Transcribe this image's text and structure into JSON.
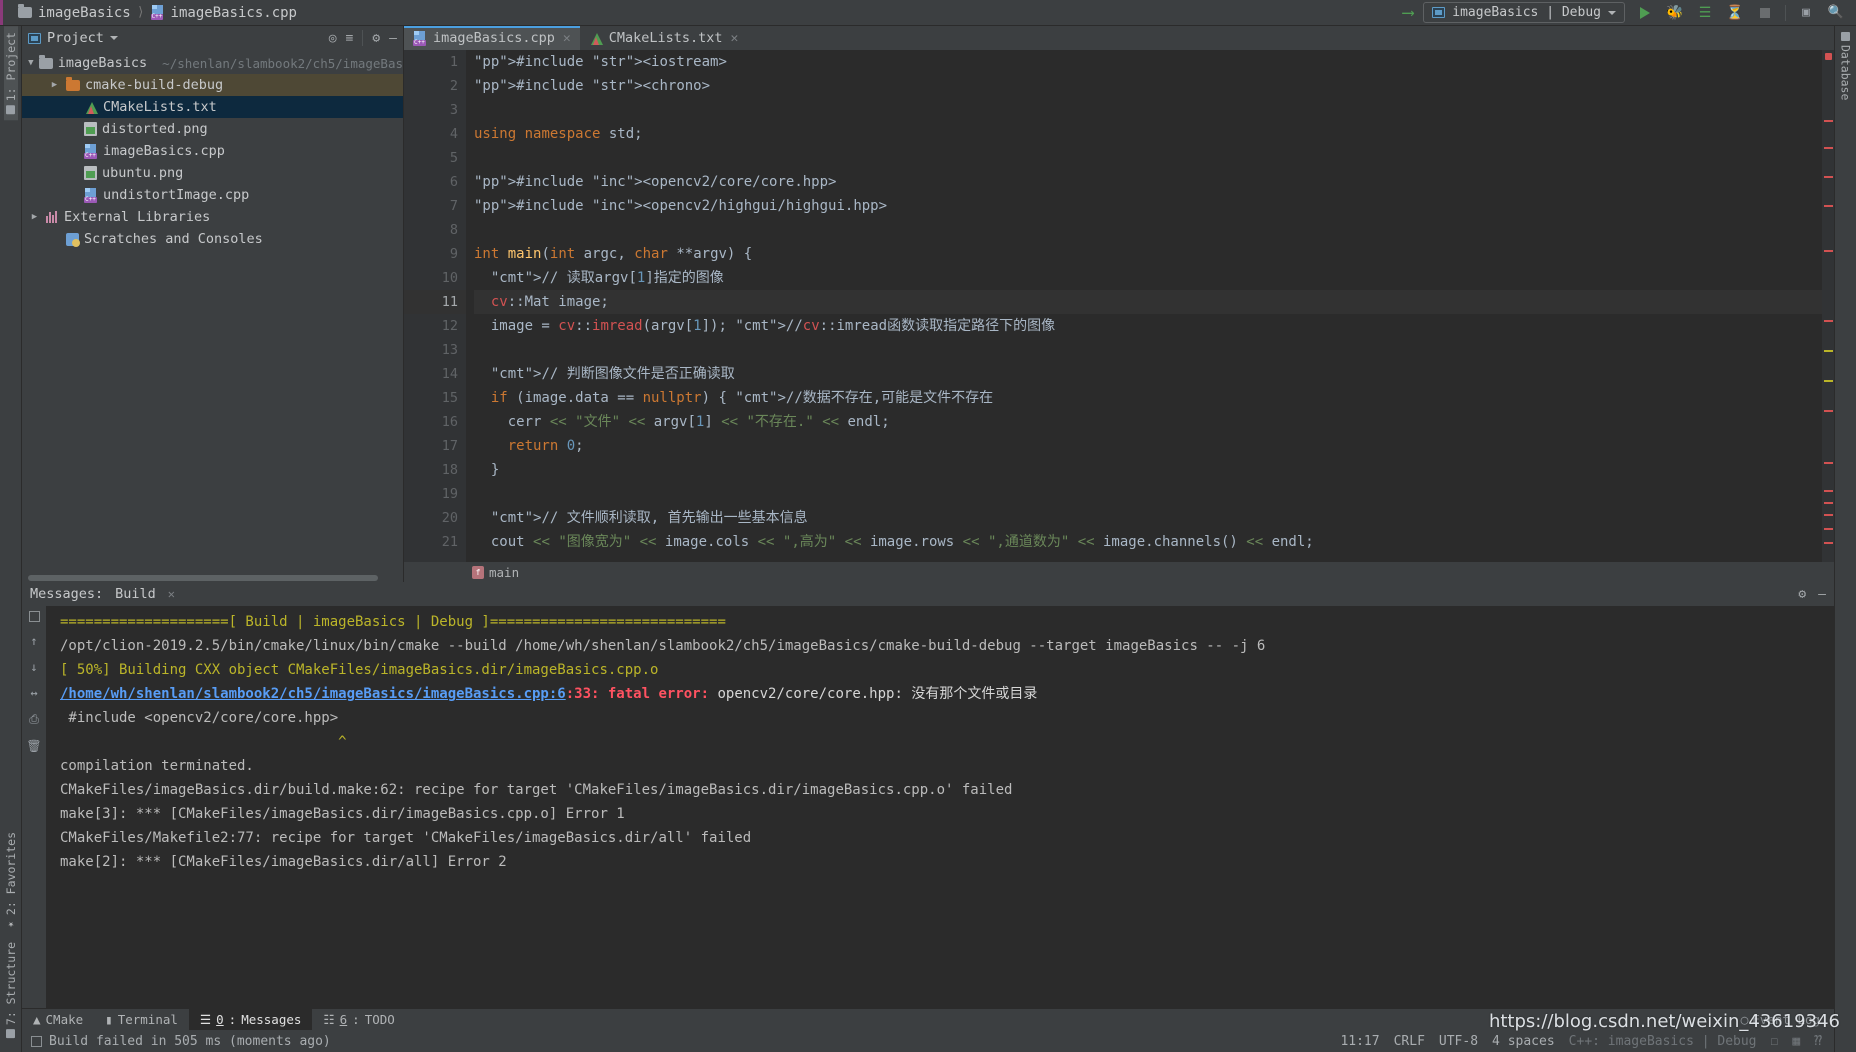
{
  "titlebar": {
    "breadcrumbs": [
      {
        "label": "imageBasics",
        "icon": "folder-icon"
      },
      {
        "label": "imageBasics.cpp",
        "icon": "cpp-file-icon"
      }
    ],
    "run_config": "imageBasics | Debug",
    "icons": [
      "jump-to-source-icon",
      "run-icon",
      "debug-icon",
      "run-with-coverage-icon",
      "profile-icon",
      "stop-icon",
      "terminal-icon",
      "search-icon"
    ]
  },
  "left_strip": {
    "top": [
      {
        "label": "1: Project",
        "icon": "project-icon"
      }
    ],
    "bottom": [
      {
        "label": "2: Favorites",
        "icon": "star-icon"
      },
      {
        "label": "7: Structure",
        "icon": "structure-icon"
      }
    ]
  },
  "right_strip": {
    "items": [
      {
        "label": "Database",
        "icon": "database-icon"
      }
    ]
  },
  "project_panel": {
    "title": "Project",
    "tools": [
      "locate-icon",
      "collapse-all-icon",
      "settings-gear-icon",
      "hide-icon"
    ],
    "tree": [
      {
        "label": "imageBasics",
        "path": "~/shenlan/slambook2/ch5/imageBas",
        "icon": "folder-icon",
        "indent": 0,
        "arrow": "down",
        "state": "normal"
      },
      {
        "label": "cmake-build-debug",
        "path": "",
        "icon": "folder-orange-icon",
        "indent": 1,
        "arrow": "right",
        "state": "olive"
      },
      {
        "label": "CMakeLists.txt",
        "path": "",
        "icon": "cmake-file-icon",
        "indent": 2,
        "arrow": "none",
        "state": "selected"
      },
      {
        "label": "distorted.png",
        "path": "",
        "icon": "png-file-icon",
        "indent": 2,
        "arrow": "none",
        "state": "normal"
      },
      {
        "label": "imageBasics.cpp",
        "path": "",
        "icon": "cpp-file-icon",
        "indent": 2,
        "arrow": "none",
        "state": "normal"
      },
      {
        "label": "ubuntu.png",
        "path": "",
        "icon": "png-file-icon",
        "indent": 2,
        "arrow": "none",
        "state": "normal"
      },
      {
        "label": "undistortImage.cpp",
        "path": "",
        "icon": "cpp-file-icon",
        "indent": 2,
        "arrow": "none",
        "state": "normal"
      },
      {
        "label": "External Libraries",
        "path": "",
        "icon": "library-icon",
        "indent": 0,
        "arrow": "right",
        "state": "normal"
      },
      {
        "label": "Scratches and Consoles",
        "path": "",
        "icon": "scratches-icon",
        "indent": 1,
        "arrow": "none",
        "state": "normal"
      }
    ]
  },
  "editor": {
    "tabs": [
      {
        "label": "imageBasics.cpp",
        "icon": "cpp-file-icon",
        "active": true,
        "closable": true
      },
      {
        "label": "CMakeLists.txt",
        "icon": "cmake-file-icon",
        "active": false,
        "closable": true
      }
    ],
    "breadcrumb": "main",
    "current_line": 11,
    "lines": [
      {
        "n": 1,
        "fold": "start",
        "text": "#include <iostream>"
      },
      {
        "n": 2,
        "fold": "end",
        "text": "#include <chrono>"
      },
      {
        "n": 3,
        "fold": "",
        "text": ""
      },
      {
        "n": 4,
        "fold": "",
        "text": "using namespace std;"
      },
      {
        "n": 5,
        "fold": "",
        "text": ""
      },
      {
        "n": 6,
        "fold": "",
        "text": "#include <opencv2/core/core.hpp>"
      },
      {
        "n": 7,
        "fold": "",
        "text": "#include <opencv2/highgui/highgui.hpp>"
      },
      {
        "n": 8,
        "fold": "",
        "text": ""
      },
      {
        "n": 9,
        "fold": "start",
        "text": "int main(int argc, char **argv) {",
        "gutter_run": true
      },
      {
        "n": 10,
        "fold": "",
        "text": "  // 读取argv[1]指定的图像"
      },
      {
        "n": 11,
        "fold": "",
        "text": "  cv::Mat image;"
      },
      {
        "n": 12,
        "fold": "",
        "text": "  image = cv::imread(argv[1]); //cv::imread函数读取指定路径下的图像"
      },
      {
        "n": 13,
        "fold": "",
        "text": ""
      },
      {
        "n": 14,
        "fold": "",
        "text": "  // 判断图像文件是否正确读取"
      },
      {
        "n": 15,
        "fold": "",
        "text": "  if (image.data == nullptr) { //数据不存在,可能是文件不存在"
      },
      {
        "n": 16,
        "fold": "",
        "text": "    cerr << \"文件\" << argv[1] << \"不存在.\" << endl;"
      },
      {
        "n": 17,
        "fold": "",
        "text": "    return 0;"
      },
      {
        "n": 18,
        "fold": "",
        "text": "  }"
      },
      {
        "n": 19,
        "fold": "",
        "text": ""
      },
      {
        "n": 20,
        "fold": "",
        "text": "  // 文件顺利读取, 首先输出一些基本信息"
      },
      {
        "n": 21,
        "fold": "",
        "text": "  cout << \"图像宽为\" << image.cols << \",高为\" << image.rows << \",通道数为\" << image.channels() << endl;"
      }
    ]
  },
  "build_panel": {
    "label": "Messages:",
    "tab": "Build",
    "lines": [
      "====================[ Build | imageBasics | Debug ]============================",
      "/opt/clion-2019.2.5/bin/cmake/linux/bin/cmake --build /home/wh/shenlan/slambook2/ch5/imageBasics/cmake-build-debug --target imageBasics -- -j 6",
      "[ 50%] Building CXX object CMakeFiles/imageBasics.dir/imageBasics.cpp.o",
      "/home/wh/shenlan/slambook2/ch5/imageBasics/imageBasics.cpp:6:33: fatal error: opencv2/core/core.hpp: 没有那个文件或目录",
      " #include <opencv2/core/core.hpp>",
      "                                 ^",
      "compilation terminated.",
      "CMakeFiles/imageBasics.dir/build.make:62: recipe for target 'CMakeFiles/imageBasics.dir/imageBasics.cpp.o' failed",
      "make[3]: *** [CMakeFiles/imageBasics.dir/imageBasics.cpp.o] Error 1",
      "CMakeFiles/Makefile2:77: recipe for target 'CMakeFiles/imageBasics.dir/all' failed",
      "make[2]: *** [CMakeFiles/imageBasics.dir/all] Error 2"
    ],
    "error_link": "/home/wh/shenlan/slambook2/ch5/imageBasics/imageBasics.cpp:6",
    "error_col": ":33:",
    "error_kw": "fatal error:",
    "error_msg": "opencv2/core/core.hpp: 没有那个文件或目录"
  },
  "bottom_tabs": [
    {
      "label": "CMake",
      "icon": "cmake-icon",
      "num": "",
      "selected": false
    },
    {
      "label": "Terminal",
      "icon": "terminal-icon",
      "num": "",
      "selected": false
    },
    {
      "label": "Messages",
      "icon": "messages-icon",
      "num": "0",
      "selected": true
    },
    {
      "label": "TODO",
      "icon": "todo-icon",
      "num": "6",
      "selected": false
    }
  ],
  "statusbar": {
    "message": "Build failed in 505 ms (moments ago)",
    "caret": "11:17",
    "line_sep": "CRLF",
    "encoding": "UTF-8",
    "indent": "4 spaces",
    "context": "C++: imageBasics | Debug",
    "event_log": "Event Log"
  },
  "watermark": "https://blog.csdn.net/weixin_43619346",
  "colors": {
    "accent": "#4b9fe0",
    "error": "#ff5261",
    "link": "#589df6",
    "keyword": "#cc7832",
    "string": "#6a8759",
    "preproc": "#bbb529",
    "comment": "#808080",
    "number": "#6897bb",
    "green": "#4f9d52"
  }
}
